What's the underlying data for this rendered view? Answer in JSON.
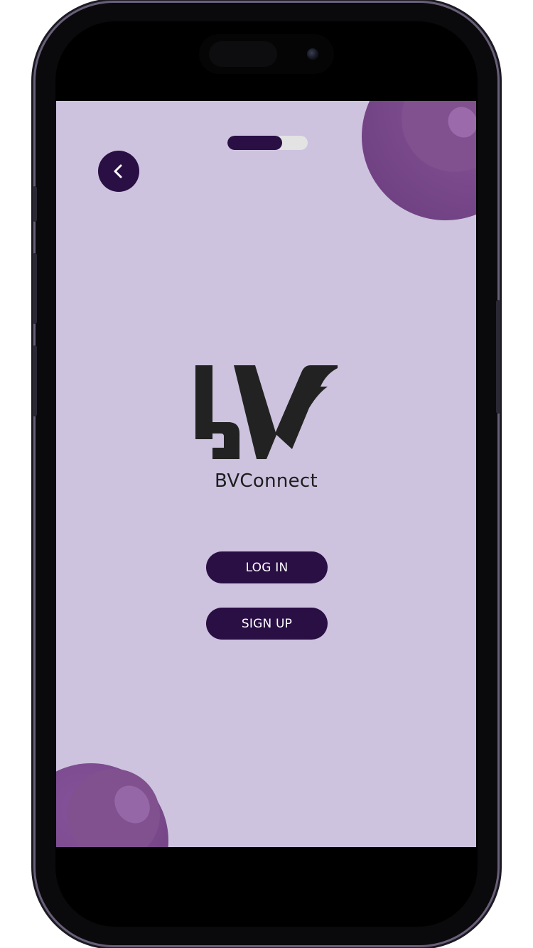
{
  "app": {
    "name": "BVConnect",
    "logo_text": "BVConnect"
  },
  "progress": {
    "fraction": 0.68
  },
  "nav": {
    "back_icon": "chevron-left-icon"
  },
  "actions": {
    "login_label": "LOG IN",
    "signup_label": "SIGN UP"
  },
  "colors": {
    "background": "#cdc3de",
    "primary": "#2a0f45",
    "accent_blob": "#7a4a8c",
    "logo": "#222222",
    "button_text": "#ffffff"
  }
}
